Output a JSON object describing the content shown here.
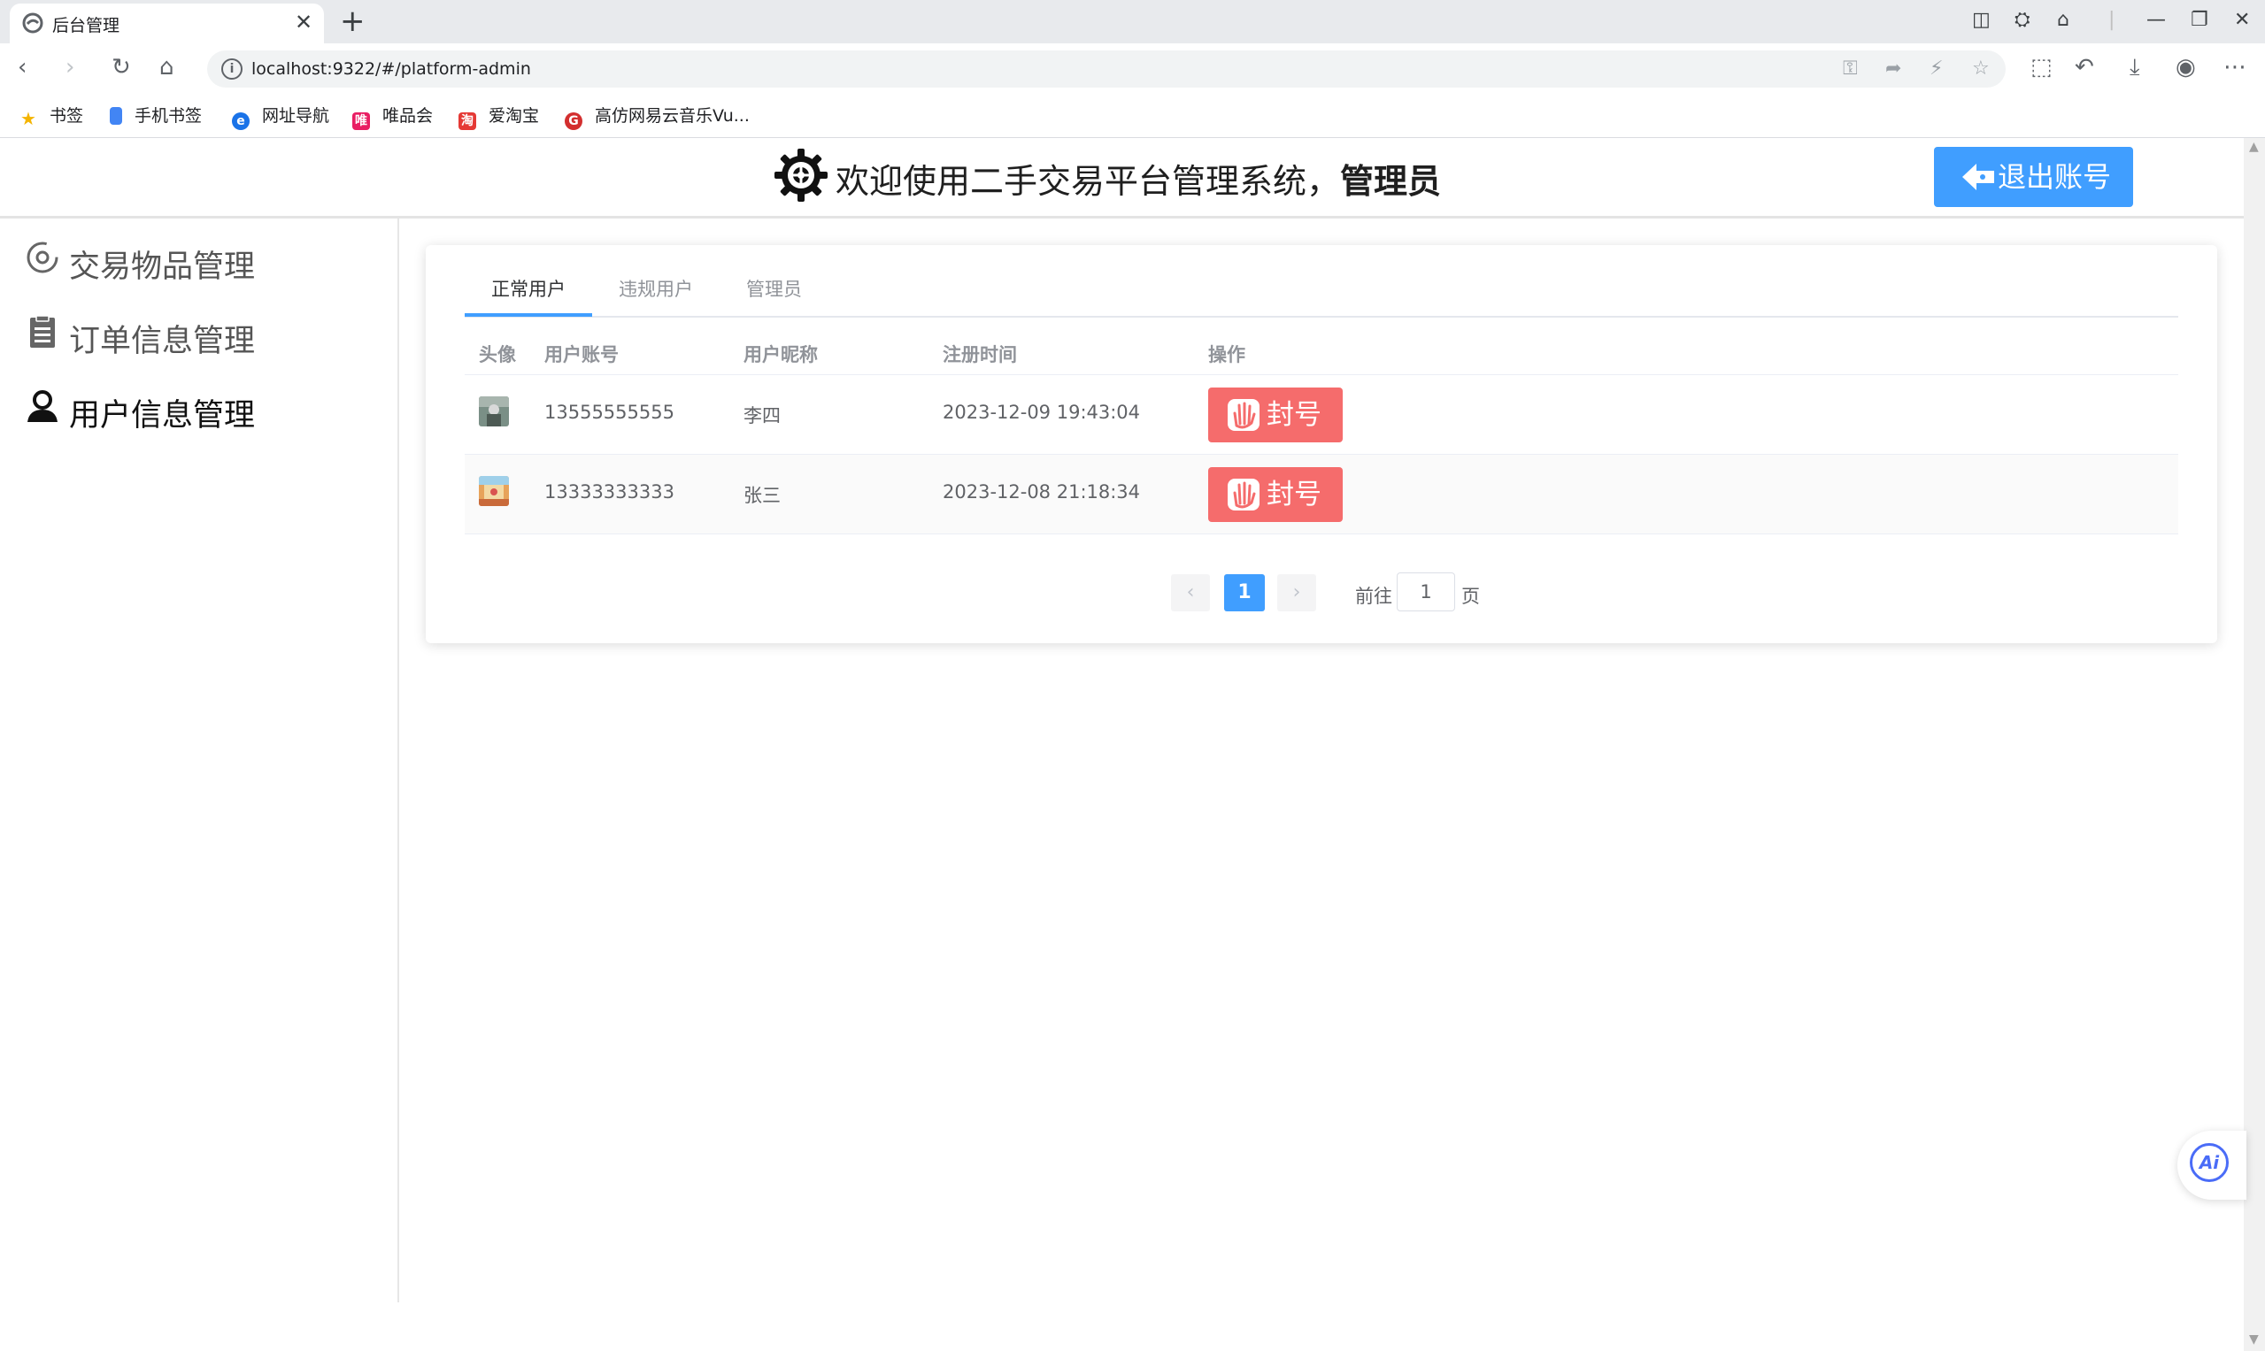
{
  "browser": {
    "tab_title": "后台管理",
    "url": "localhost:9322/#/platform-admin",
    "bookmarks": [
      {
        "label": "书签",
        "icon": "star-icon",
        "color": "#f4b400"
      },
      {
        "label": "手机书签",
        "icon": "phone-bookmark-icon",
        "color": "#4285f4"
      },
      {
        "label": "网址导航",
        "icon": "nav-icon",
        "color": "#1a73e8"
      },
      {
        "label": "唯品会",
        "icon": "vip-icon",
        "color": "#e91e63"
      },
      {
        "label": "爱淘宝",
        "icon": "taobao-icon",
        "color": "#e53935"
      },
      {
        "label": "高仿网易云音乐Vu...",
        "icon": "netease-icon",
        "color": "#d32f2f"
      }
    ]
  },
  "header": {
    "title_prefix": "欢迎使用二手交易平台管理系统，",
    "user_role": "管理员",
    "logout_label": "退出账号",
    "accent_color": "#409eff"
  },
  "sidebar": {
    "items": [
      {
        "label": "交易物品管理",
        "icon": "goods-icon",
        "active": false
      },
      {
        "label": "订单信息管理",
        "icon": "order-icon",
        "active": false
      },
      {
        "label": "用户信息管理",
        "icon": "user-icon",
        "active": true
      }
    ]
  },
  "tabs": [
    {
      "label": "正常用户",
      "active": true
    },
    {
      "label": "违规用户",
      "active": false
    },
    {
      "label": "管理员",
      "active": false
    }
  ],
  "table": {
    "columns": [
      "头像",
      "用户账号",
      "用户昵称",
      "注册时间",
      "操作"
    ],
    "rows": [
      {
        "account": "13555555555",
        "nickname": "李四",
        "registered": "2023-12-09 19:43:04",
        "action": "封号"
      },
      {
        "account": "13333333333",
        "nickname": "张三",
        "registered": "2023-12-08 21:18:34",
        "action": "封号"
      }
    ]
  },
  "pagination": {
    "current_page": "1",
    "goto_label": "前往",
    "page_suffix": "页",
    "goto_value": "1"
  },
  "colors": {
    "primary": "#409eff",
    "danger": "#f56c6c"
  }
}
